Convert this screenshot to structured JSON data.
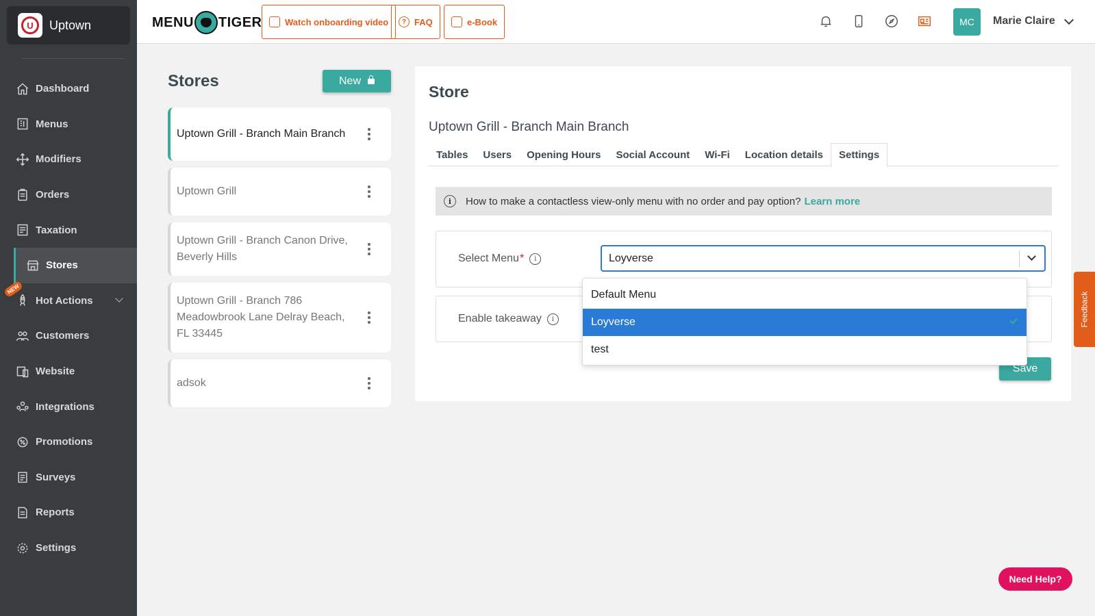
{
  "brand": {
    "name": "Uptown",
    "logo_letter": "U"
  },
  "sidebar": {
    "items": [
      {
        "label": "Dashboard",
        "icon": "home-icon"
      },
      {
        "label": "Menus",
        "icon": "menu-book-icon"
      },
      {
        "label": "Modifiers",
        "icon": "move-arrows-icon"
      },
      {
        "label": "Orders",
        "icon": "clipboard-icon"
      },
      {
        "label": "Taxation",
        "icon": "tax-icon"
      },
      {
        "label": "Stores",
        "icon": "store-icon",
        "active": true
      },
      {
        "label": "Hot Actions",
        "icon": "rocket-icon",
        "badge": "NEW"
      },
      {
        "label": "Customers",
        "icon": "users-icon"
      },
      {
        "label": "Website",
        "icon": "devices-icon"
      },
      {
        "label": "Integrations",
        "icon": "integrations-icon"
      },
      {
        "label": "Promotions",
        "icon": "badge-icon"
      },
      {
        "label": "Surveys",
        "icon": "checklist-icon"
      },
      {
        "label": "Reports",
        "icon": "report-icon"
      },
      {
        "label": "Settings",
        "icon": "gear-icon"
      }
    ]
  },
  "topbar": {
    "logo_left": "MENU",
    "logo_right": "TIGER",
    "buttons": [
      "Watch onboarding video",
      "FAQ",
      "e-Book"
    ],
    "icons": [
      "bell-icon",
      "phone-icon",
      "compass-icon",
      "news-icon"
    ],
    "avatar_initials": "MC",
    "user_name": "Marie Claire"
  },
  "stores": {
    "title": "Stores",
    "new_label": "New",
    "list": [
      {
        "name": "Uptown Grill - Branch Main Branch",
        "selected": true
      },
      {
        "name": "Uptown Grill"
      },
      {
        "name": "Uptown Grill - Branch Canon Drive, Beverly Hills"
      },
      {
        "name": "Uptown Grill - Branch 786 Meadowbrook Lane Delray Beach, FL 33445"
      },
      {
        "name": "adsok"
      }
    ]
  },
  "panel": {
    "title": "Store",
    "subtitle": "Uptown Grill - Branch Main Branch",
    "tabs": [
      "Tables",
      "Users",
      "Opening Hours",
      "Social Account",
      "Wi-Fi",
      "Location details",
      "Settings"
    ],
    "active_tab": "Settings",
    "info_text": "How to make a contactless view-only menu with no order and pay option?",
    "info_link": "Learn more",
    "select_menu_label": "Select Menu",
    "required_mark": "*",
    "select_value": "Loyverse",
    "options": [
      "Default Menu",
      "Loyverse",
      "test"
    ],
    "selected_option": "Loyverse",
    "takeaway_label": "Enable takeaway",
    "save_label": "Save"
  },
  "feedback_label": "Feedback",
  "need_help_label": "Need Help?",
  "colors": {
    "accent": "#3aa99f",
    "orange": "#e35d1a",
    "sidebar": "#3a3d3f",
    "select_blue": "#2a7bd6",
    "help_pink": "#e0115f"
  }
}
